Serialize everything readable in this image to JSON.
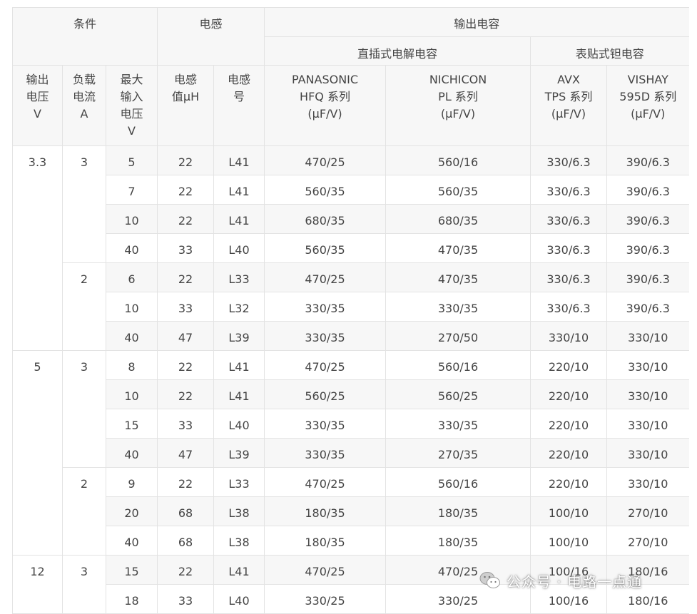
{
  "header": {
    "conditions": "条件",
    "inductor": "电感",
    "output_cap": "输出电容",
    "through_hole": "直插式电解电容",
    "smd": "表贴式钽电容",
    "cols": [
      [
        "输出",
        "电压",
        "V"
      ],
      [
        "负载",
        "电流",
        "A"
      ],
      [
        "最大",
        "输入",
        "电压",
        "V"
      ],
      [
        "电感",
        "值μH"
      ],
      [
        "电感",
        "号"
      ],
      [
        "PANASONIC",
        "HFQ 系列",
        "(μF/V)"
      ],
      [
        "NICHICON",
        "PL 系列",
        "(μF/V)"
      ],
      [
        "AVX",
        "TPS 系列",
        "(μF/V)"
      ],
      [
        "VISHAY",
        "595D 系列",
        "(μF/V)"
      ]
    ]
  },
  "groups": [
    {
      "vout": "3.3",
      "loads": [
        {
          "current": "3",
          "rows": [
            [
              "5",
              "22",
              "L41",
              "470/25",
              "560/16",
              "330/6.3",
              "390/6.3"
            ],
            [
              "7",
              "22",
              "L41",
              "560/35",
              "560/35",
              "330/6.3",
              "390/6.3"
            ],
            [
              "10",
              "22",
              "L41",
              "680/35",
              "680/35",
              "330/6.3",
              "390/6.3"
            ],
            [
              "40",
              "33",
              "L40",
              "560/35",
              "470/35",
              "330/6.3",
              "390/6.3"
            ]
          ]
        },
        {
          "current": "2",
          "rows": [
            [
              "6",
              "22",
              "L33",
              "470/25",
              "470/35",
              "330/6.3",
              "390/6.3"
            ],
            [
              "10",
              "33",
              "L32",
              "330/35",
              "330/35",
              "330/6.3",
              "390/6.3"
            ],
            [
              "40",
              "47",
              "L39",
              "330/35",
              "270/50",
              "330/10",
              "330/10"
            ]
          ]
        }
      ]
    },
    {
      "vout": "5",
      "loads": [
        {
          "current": "3",
          "rows": [
            [
              "8",
              "22",
              "L41",
              "470/25",
              "560/16",
              "220/10",
              "330/10"
            ],
            [
              "10",
              "22",
              "L41",
              "560/25",
              "560/25",
              "220/10",
              "330/10"
            ],
            [
              "15",
              "33",
              "L40",
              "330/35",
              "330/35",
              "220/10",
              "330/10"
            ],
            [
              "40",
              "47",
              "L39",
              "330/35",
              "270/35",
              "220/10",
              "330/10"
            ]
          ]
        },
        {
          "current": "2",
          "rows": [
            [
              "9",
              "22",
              "L33",
              "470/25",
              "560/16",
              "220/10",
              "330/10"
            ],
            [
              "20",
              "68",
              "L38",
              "180/35",
              "180/35",
              "100/10",
              "270/10"
            ],
            [
              "40",
              "68",
              "L38",
              "180/35",
              "180/35",
              "100/10",
              "270/10"
            ]
          ]
        }
      ]
    },
    {
      "vout": "12",
      "loads": [
        {
          "current": "3",
          "rows": [
            [
              "15",
              "22",
              "L41",
              "470/25",
              "470/25",
              "100/16",
              "180/16"
            ],
            [
              "18",
              "33",
              "L40",
              "330/25",
              "330/25",
              "100/16",
              "180/16"
            ]
          ]
        }
      ]
    }
  ],
  "watermark": {
    "text": "公众号 · 电路一点通",
    "icon": "wechat-icon"
  }
}
